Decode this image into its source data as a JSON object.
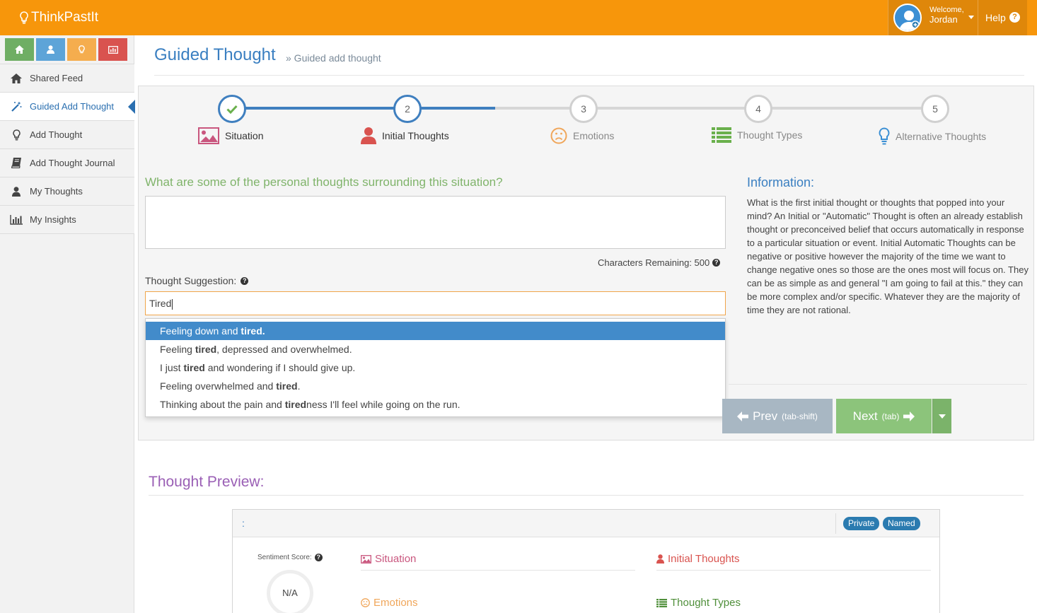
{
  "app": {
    "brand": "ThinkPastIt"
  },
  "header": {
    "welcome": "Welcome,",
    "user_name": "Jordan",
    "help": "Help"
  },
  "sidebar": {
    "quick_colors": [
      "#6fae64",
      "#5da4d8",
      "#f5ad4e",
      "#d9534f"
    ],
    "items": [
      {
        "label": "Shared Feed",
        "icon": "home-icon"
      },
      {
        "label": "Guided Add Thought",
        "icon": "magic-wand-icon",
        "active": true
      },
      {
        "label": "Add Thought",
        "icon": "lightbulb-icon"
      },
      {
        "label": "Add Thought Journal",
        "icon": "book-icon"
      },
      {
        "label": "My Thoughts",
        "icon": "user-icon"
      },
      {
        "label": "My Insights",
        "icon": "bar-chart-icon"
      }
    ]
  },
  "page": {
    "title": "Guided Thought",
    "breadcrumb": "» Guided add thought"
  },
  "steps": [
    {
      "number": "",
      "label": "Situation",
      "state": "done",
      "color": "#c9567e"
    },
    {
      "number": "2",
      "label": "Initial Thoughts",
      "state": "current",
      "color": "#d9534f"
    },
    {
      "number": "3",
      "label": "Emotions",
      "state": "todo",
      "color": "#f0a65a"
    },
    {
      "number": "4",
      "label": "Thought Types",
      "state": "todo",
      "color": "#6ab04c"
    },
    {
      "number": "5",
      "label": "Alternative Thoughts",
      "state": "todo",
      "color": "#3a8fd4"
    }
  ],
  "form": {
    "question": "What are some of the personal thoughts surrounding this situation?",
    "thought_value": "",
    "chars_remaining": "Characters Remaining: 500",
    "suggestion_label": "Thought Suggestion:",
    "suggestion_value": "Tired",
    "suggestions": [
      {
        "before": "Feeling down and ",
        "match": "tired",
        "after": "."
      },
      {
        "before": "Feeling ",
        "match": "tired",
        "after": ", depressed and overwhelmed."
      },
      {
        "before": "I just ",
        "match": "tired",
        "after": " and wondering if I should give up."
      },
      {
        "before": "Feeling overwhelmed and ",
        "match": "tired",
        "after": "."
      },
      {
        "before": "Thinking about the pain and ",
        "match": "tired",
        "after": "ness I'll feel while going on the run."
      }
    ]
  },
  "info": {
    "title": "Information:",
    "text": "What is the first initial thought or thoughts that popped into your mind? An Initial or \"Automatic\" Thought is often an already establish thought or preconceived belief that occurs automatically in response to a particular situation or event. Initial Automatic Thoughts can be negative or positive however the majority of the time we want to change negative ones so those are the ones most will focus on. They can be as simple as and general \"I am going to fail at this.\" they can be more complex and/or specific. Whatever they are the majority of time they are not rational."
  },
  "buttons": {
    "prev_label": "Prev",
    "prev_hint": "(tab-shift)",
    "next_label": "Next",
    "next_hint": "(tab)"
  },
  "preview": {
    "title": "Thought Preview:",
    "colon": ":",
    "badges": [
      "Private",
      "Named"
    ],
    "sentiment_label": "Sentiment Score:",
    "sentiment_value": "N/A",
    "sections": {
      "situation": "Situation",
      "initial_thoughts": "Initial Thoughts",
      "emotions": "Emotions",
      "thought_types": "Thought Types"
    }
  }
}
